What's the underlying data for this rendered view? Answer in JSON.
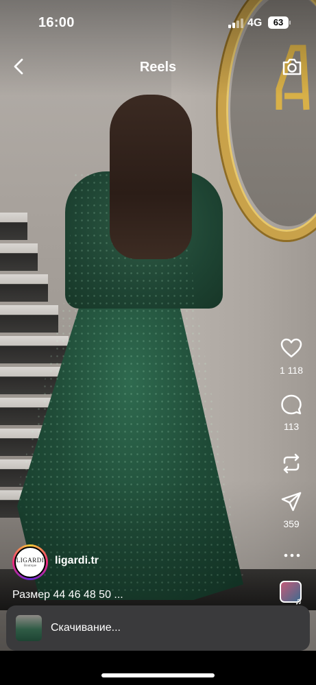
{
  "status_bar": {
    "time": "16:00",
    "network": "4G",
    "battery": "63"
  },
  "header": {
    "title": "Reels",
    "back_icon": "chevron-left-icon",
    "camera_icon": "camera-icon"
  },
  "actions": {
    "likes": "1 118",
    "comments": "113",
    "shares": "359"
  },
  "account": {
    "username": "ligardi.tr",
    "avatar_logo": "LIGARDI",
    "avatar_sub": "Boutique"
  },
  "caption": "Размер 44 46 48 50 ...",
  "toast": {
    "text": "Скачивание..."
  },
  "colors": {
    "dress": "#1f4b37",
    "toast_bg": "#3a3a3c",
    "gold_frame": "#c9a24a"
  }
}
